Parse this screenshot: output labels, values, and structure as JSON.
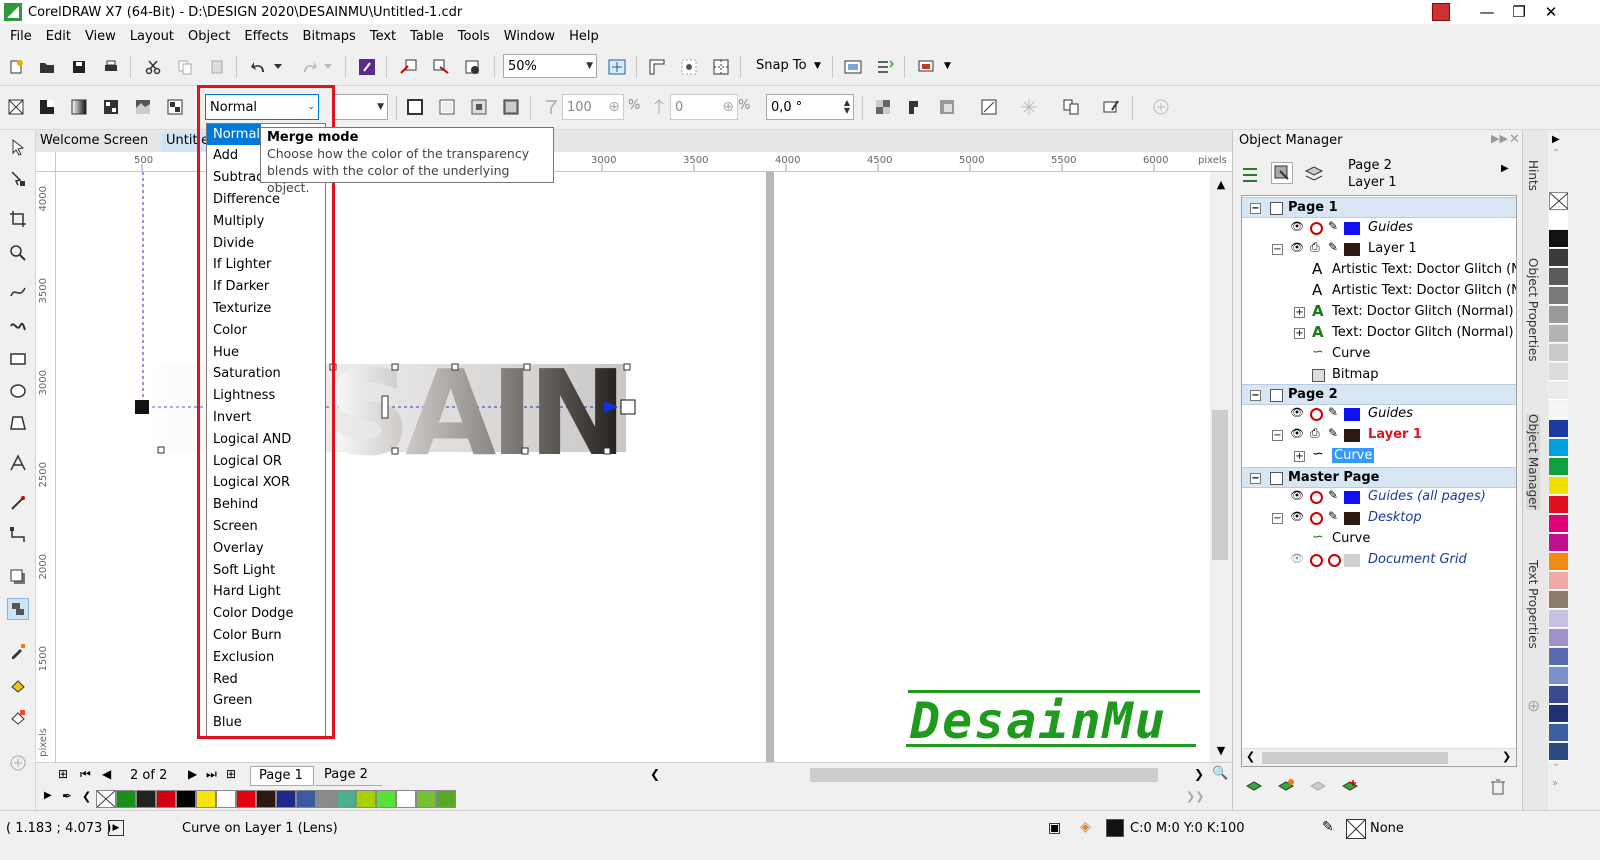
{
  "window": {
    "title": "CorelDRAW X7 (64-Bit) - D:\\DESIGN 2020\\DESAINMU\\Untitled-1.cdr",
    "minimize": "—",
    "restore": "❐",
    "close": "✕"
  },
  "menu": [
    "File",
    "Edit",
    "View",
    "Layout",
    "Object",
    "Effects",
    "Bitmaps",
    "Text",
    "Table",
    "Tools",
    "Window",
    "Help"
  ],
  "standard_toolbar": {
    "zoom_value": "50%",
    "snap_to": "Snap To"
  },
  "property_bar": {
    "merge_mode_value": "Normal",
    "opacity_value": "100",
    "opacity_unit": "%",
    "angle_value": "0",
    "angle_unit": "%",
    "rotation_value": "0,0 °"
  },
  "merge_mode_dropdown": {
    "options": [
      "Normal",
      "Add",
      "Subtract",
      "Difference",
      "Multiply",
      "Divide",
      "If Lighter",
      "If Darker",
      "Texturize",
      "Color",
      "Hue",
      "Saturation",
      "Lightness",
      "Invert",
      "Logical AND",
      "Logical OR",
      "Logical XOR",
      "Behind",
      "Screen",
      "Overlay",
      "Soft Light",
      "Hard Light",
      "Color Dodge",
      "Color Burn",
      "Exclusion",
      "Red",
      "Green",
      "Blue"
    ],
    "selected": "Normal"
  },
  "tooltip": {
    "title": "Merge mode",
    "line1": "Choose how the color of the transparency",
    "line2": "blends with the color of the underlying object."
  },
  "doc_tabs": {
    "welcome": "Welcome Screen",
    "untitled": "Untitled-1"
  },
  "rulers": {
    "h_ticks": [
      "500",
      "3000",
      "3500",
      "4000",
      "4500",
      "5000",
      "5500",
      "6000"
    ],
    "h_unit": "pixels",
    "v_ticks": [
      "4000",
      "3500",
      "3000",
      "2500",
      "2000",
      "1500"
    ],
    "v_unit": "pixels"
  },
  "canvas": {
    "artwork_text": "SAIN"
  },
  "page_nav": {
    "counter": "2 of 2",
    "page1": "Page 1",
    "page2": "Page 2"
  },
  "status": {
    "coords": "( 1.183 ; 4.073 )",
    "object_info": "Curve on Layer 1  (Lens)",
    "fill": "C:0 M:0 Y:0 K:100",
    "outline": "None"
  },
  "object_manager": {
    "title": "Object Manager",
    "current_page": "Page 2",
    "current_layer": "Layer 1",
    "tree": {
      "page1": "Page 1",
      "p1_guides": "Guides",
      "p1_layer1": "Layer 1",
      "p1_art1": "Artistic Text: Doctor Glitch (No",
      "p1_art2": "Artistic Text: Doctor Glitch (No",
      "p1_text1": "Text: Doctor Glitch (Normal)",
      "p1_text2": "Text: Doctor Glitch (Normal)",
      "p1_curve": "Curve",
      "p1_bitmap": "Bitmap",
      "page2": "Page 2",
      "p2_guides": "Guides",
      "p2_layer1": "Layer 1",
      "p2_curve": "Curve",
      "master": "Master Page",
      "m_guides": "Guides (all pages)",
      "m_desktop": "Desktop",
      "m_curve": "Curve",
      "m_grid": "Document Grid"
    }
  },
  "docker_tabs": [
    "Hints",
    "Object Properties",
    "Object Manager",
    "Text Properties"
  ],
  "watermark": "DesainMu",
  "colors": {
    "accent": "#0078d7",
    "highlight_red": "#e0141e",
    "watermark_green": "#1f9a1f",
    "page_header": "#d8e6f4"
  }
}
